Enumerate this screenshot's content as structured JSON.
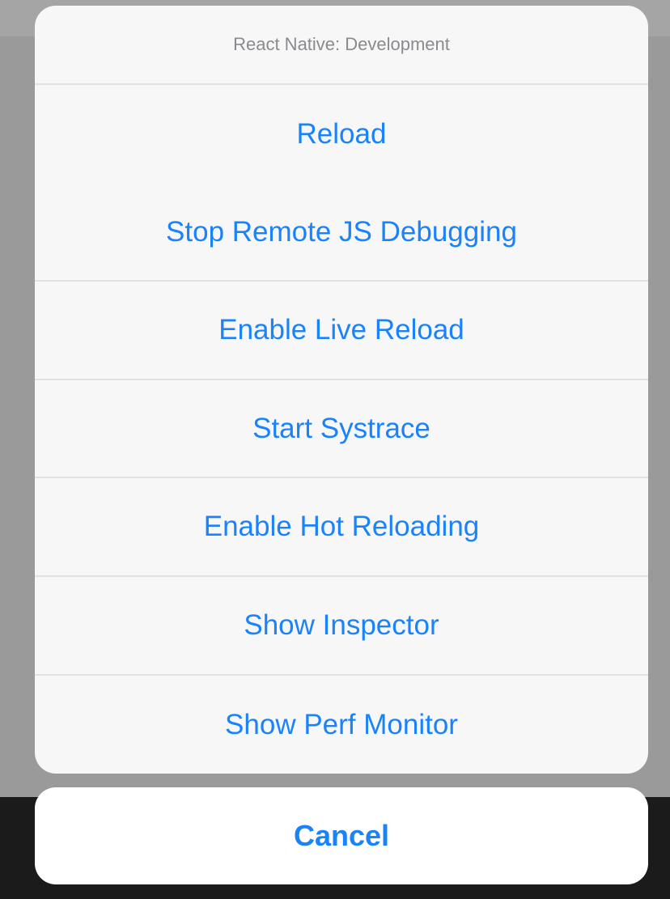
{
  "action_sheet": {
    "title": "React Native: Development",
    "actions": [
      {
        "label": "Reload"
      },
      {
        "label": "Stop Remote JS Debugging"
      },
      {
        "label": "Enable Live Reload"
      },
      {
        "label": "Start Systrace"
      },
      {
        "label": "Enable Hot Reloading"
      },
      {
        "label": "Show Inspector"
      },
      {
        "label": "Show Perf Monitor"
      }
    ],
    "cancel_label": "Cancel"
  },
  "colors": {
    "accent": "#1a82fb",
    "sheet_background": "#f7f7f7",
    "title_text": "#8a8a8f",
    "separator": "#e2e2e2",
    "dimmed_backdrop": "#9a9a9a"
  }
}
